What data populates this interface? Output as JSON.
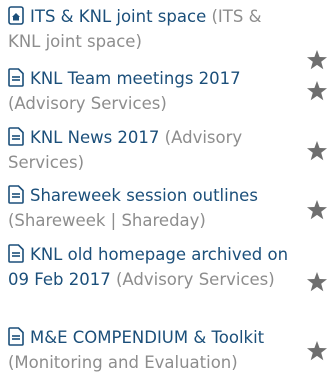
{
  "items": [
    {
      "icon": "home-icon",
      "title": "ITS & KNL joint space",
      "space": "(ITS & KNL joint space)"
    },
    {
      "icon": "page-icon",
      "title": "KNL Team meetings 2017",
      "space": "(Advisory Services)"
    },
    {
      "icon": "page-icon",
      "title": "KNL News 2017",
      "space": "(Advisory Services)"
    },
    {
      "icon": "page-icon",
      "title": "Shareweek session outlines",
      "space": "(Shareweek | Shareday)"
    },
    {
      "icon": "page-icon",
      "title": "KNL old homepage archived on 09 Feb 2017",
      "space": "(Advisory Services)"
    },
    {
      "icon": "page-icon",
      "title": "M&E COMPENDIUM & Toolkit",
      "space": "(Monitoring and Evaluation)"
    }
  ],
  "colors": {
    "title": "#1b4f7a",
    "space": "#8d8d8d",
    "star": "#6f6f6f"
  }
}
